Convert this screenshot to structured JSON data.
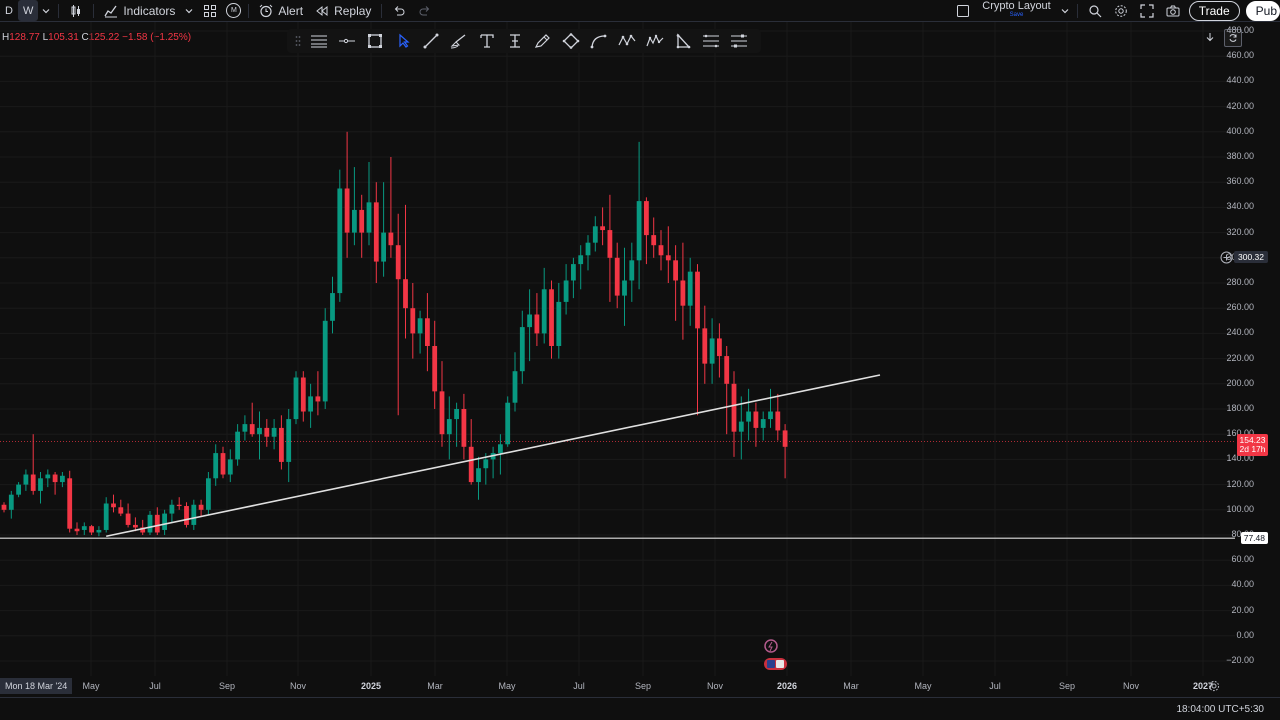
{
  "toolbar": {
    "timeframes": [
      "D",
      "W"
    ],
    "active_timeframe": "W",
    "indicators_label": "Indicators",
    "alert_label": "Alert",
    "replay_label": "Replay",
    "layout_name": "Crypto Layout",
    "layout_status": "Save",
    "trade_label": "Trade",
    "publish_label": "Pub",
    "m_badge": "M"
  },
  "ohlc": {
    "H": "128.77",
    "L": "105.31",
    "C": "125.22",
    "change": "−1.58 (−1.25%)",
    "H_key": "H",
    "L_key": "L",
    "C_key": "C"
  },
  "price_axis": {
    "ticks": [
      "480.00",
      "460.00",
      "440.00",
      "420.00",
      "400.00",
      "380.00",
      "360.00",
      "340.00",
      "320.00",
      "300.00",
      "280.00",
      "260.00",
      "240.00",
      "220.00",
      "200.00",
      "180.00",
      "160.00",
      "140.00",
      "120.00",
      "100.00",
      "80.00",
      "60.00",
      "40.00",
      "20.00",
      "0.00",
      "−20.00"
    ],
    "tick_values": [
      480,
      460,
      440,
      420,
      400,
      380,
      360,
      340,
      320,
      300,
      280,
      260,
      240,
      220,
      200,
      180,
      160,
      140,
      120,
      100,
      80,
      60,
      40,
      20,
      0,
      -20
    ],
    "current_price": "154.23",
    "countdown": "2d 17h",
    "horizontal_line_price": "77.48",
    "crosshair_price": "300.32"
  },
  "time_axis": {
    "first_label": "Mon 18 Mar '24",
    "labels": [
      {
        "t": "May",
        "x": 91,
        "year": false
      },
      {
        "t": "Jul",
        "x": 155,
        "year": false
      },
      {
        "t": "Sep",
        "x": 227,
        "year": false
      },
      {
        "t": "Nov",
        "x": 298,
        "year": false
      },
      {
        "t": "2025",
        "x": 371,
        "year": true
      },
      {
        "t": "Mar",
        "x": 435,
        "year": false
      },
      {
        "t": "May",
        "x": 507,
        "year": false
      },
      {
        "t": "Jul",
        "x": 579,
        "year": false
      },
      {
        "t": "Sep",
        "x": 643,
        "year": false
      },
      {
        "t": "Nov",
        "x": 715,
        "year": false
      },
      {
        "t": "2026",
        "x": 787,
        "year": true
      },
      {
        "t": "Mar",
        "x": 851,
        "year": false
      },
      {
        "t": "May",
        "x": 923,
        "year": false
      },
      {
        "t": "Jul",
        "x": 995,
        "year": false
      },
      {
        "t": "Sep",
        "x": 1067,
        "year": false
      },
      {
        "t": "Nov",
        "x": 1131,
        "year": false
      },
      {
        "t": "2027",
        "x": 1203,
        "year": true
      }
    ]
  },
  "status": {
    "time": "18:04:00 UTC+5:30"
  },
  "colors": {
    "up": "#089981",
    "down": "#f23645",
    "bg": "#0f0f0f",
    "grid": "#1c1c1c",
    "line": "#e0e0e0"
  },
  "icons": {
    "drawing_tools": [
      "grip-icon",
      "horizontal-lines-icon",
      "ray-icon",
      "rectangle-icon",
      "cursor-icon",
      "trendline-icon",
      "brush-icon",
      "text-icon",
      "text-cursor-icon",
      "pen-icon",
      "diamond-icon",
      "curve-icon",
      "zigzag-icon",
      "pattern-icon",
      "triangle-icon",
      "fib-icon",
      "measure-icon"
    ]
  },
  "chart_data": {
    "type": "candlestick",
    "title": "",
    "ylim": [
      -20,
      480
    ],
    "candles": [
      [
        104,
        106,
        98,
        100
      ],
      [
        100,
        115,
        93,
        112
      ],
      [
        112,
        122,
        110,
        120
      ],
      [
        120,
        132,
        115,
        128
      ],
      [
        128,
        160,
        112,
        115
      ],
      [
        115,
        130,
        105,
        125
      ],
      [
        125,
        132,
        118,
        128
      ],
      [
        128,
        130,
        112,
        122
      ],
      [
        122,
        130,
        118,
        127
      ],
      [
        125,
        131,
        82,
        85
      ],
      [
        85,
        90,
        80,
        83
      ],
      [
        84,
        90,
        80,
        87
      ],
      [
        87,
        88,
        80,
        82
      ],
      [
        82,
        87,
        79,
        84
      ],
      [
        84,
        110,
        82,
        105
      ],
      [
        105,
        112,
        98,
        102
      ],
      [
        102,
        108,
        95,
        97
      ],
      [
        97,
        105,
        86,
        88
      ],
      [
        88,
        94,
        83,
        86
      ],
      [
        86,
        92,
        80,
        82
      ],
      [
        82,
        99,
        80,
        96
      ],
      [
        96,
        102,
        80,
        82
      ],
      [
        84,
        100,
        80,
        97
      ],
      [
        97,
        108,
        90,
        104
      ],
      [
        104,
        110,
        100,
        103
      ],
      [
        103,
        106,
        86,
        88
      ],
      [
        88,
        108,
        84,
        104
      ],
      [
        104,
        108,
        95,
        100
      ],
      [
        100,
        130,
        96,
        125
      ],
      [
        125,
        152,
        119,
        145
      ],
      [
        145,
        150,
        125,
        128
      ],
      [
        128,
        148,
        122,
        140
      ],
      [
        140,
        168,
        135,
        162
      ],
      [
        162,
        175,
        155,
        168
      ],
      [
        168,
        185,
        158,
        160
      ],
      [
        160,
        178,
        140,
        165
      ],
      [
        165,
        172,
        150,
        158
      ],
      [
        158,
        172,
        148,
        165
      ],
      [
        165,
        175,
        132,
        138
      ],
      [
        138,
        180,
        122,
        172
      ],
      [
        172,
        210,
        168,
        205
      ],
      [
        205,
        210,
        170,
        178
      ],
      [
        178,
        200,
        165,
        190
      ],
      [
        190,
        210,
        175,
        186
      ],
      [
        186,
        260,
        180,
        250
      ],
      [
        250,
        285,
        240,
        272
      ],
      [
        272,
        370,
        265,
        355
      ],
      [
        355,
        400,
        300,
        320
      ],
      [
        320,
        372,
        310,
        338
      ],
      [
        338,
        350,
        300,
        320
      ],
      [
        320,
        376,
        310,
        344
      ],
      [
        344,
        360,
        280,
        297
      ],
      [
        297,
        360,
        285,
        320
      ],
      [
        320,
        380,
        300,
        310
      ],
      [
        310,
        335,
        175,
        283
      ],
      [
        283,
        342,
        236,
        260
      ],
      [
        260,
        280,
        220,
        240
      ],
      [
        240,
        258,
        224,
        252
      ],
      [
        252,
        272,
        210,
        230
      ],
      [
        230,
        250,
        180,
        194
      ],
      [
        194,
        218,
        150,
        160
      ],
      [
        160,
        190,
        140,
        172
      ],
      [
        172,
        185,
        150,
        180
      ],
      [
        180,
        192,
        140,
        150
      ],
      [
        150,
        172,
        120,
        122
      ],
      [
        122,
        142,
        108,
        133
      ],
      [
        133,
        145,
        120,
        140
      ],
      [
        140,
        150,
        125,
        145
      ],
      [
        145,
        160,
        128,
        152
      ],
      [
        152,
        190,
        150,
        185
      ],
      [
        185,
        225,
        178,
        210
      ],
      [
        210,
        258,
        200,
        245
      ],
      [
        245,
        275,
        218,
        255
      ],
      [
        255,
        272,
        230,
        240
      ],
      [
        240,
        292,
        232,
        275
      ],
      [
        275,
        282,
        220,
        230
      ],
      [
        230,
        280,
        220,
        265
      ],
      [
        265,
        295,
        255,
        282
      ],
      [
        282,
        300,
        268,
        295
      ],
      [
        295,
        310,
        275,
        302
      ],
      [
        302,
        318,
        290,
        312
      ],
      [
        312,
        333,
        305,
        325
      ],
      [
        325,
        340,
        310,
        322
      ],
      [
        322,
        350,
        265,
        300
      ],
      [
        300,
        312,
        260,
        270
      ],
      [
        270,
        308,
        246,
        282
      ],
      [
        282,
        312,
        265,
        298
      ],
      [
        298,
        392,
        275,
        345
      ],
      [
        345,
        348,
        295,
        318
      ],
      [
        318,
        332,
        300,
        310
      ],
      [
        310,
        322,
        290,
        302
      ],
      [
        302,
        325,
        280,
        298
      ],
      [
        298,
        310,
        250,
        282
      ],
      [
        282,
        312,
        235,
        262
      ],
      [
        262,
        300,
        246,
        289
      ],
      [
        289,
        295,
        175,
        244
      ],
      [
        244,
        262,
        200,
        216
      ],
      [
        216,
        252,
        200,
        236
      ],
      [
        236,
        248,
        205,
        222
      ],
      [
        222,
        230,
        160,
        200
      ],
      [
        200,
        210,
        142,
        162
      ],
      [
        162,
        190,
        140,
        170
      ],
      [
        170,
        196,
        155,
        178
      ],
      [
        178,
        185,
        150,
        165
      ],
      [
        165,
        178,
        155,
        172
      ],
      [
        172,
        196,
        165,
        178
      ],
      [
        178,
        192,
        155,
        163
      ],
      [
        163,
        168,
        125,
        150
      ]
    ],
    "trendline": {
      "from": [
        "2024-06-24",
        79
      ],
      "to": [
        "2026-07-06",
        207
      ]
    },
    "horizontal_line": 77.48,
    "current_price_line": 154.23
  }
}
